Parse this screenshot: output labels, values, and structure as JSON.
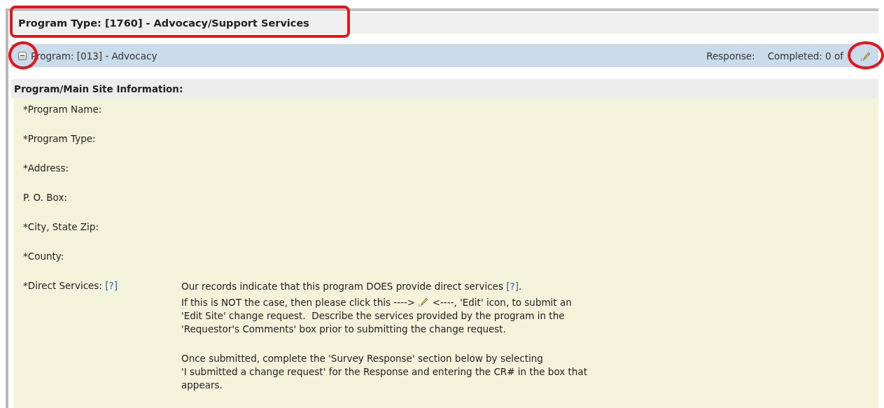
{
  "program_type": {
    "title": "Program Type: [1760] - Advocacy/Support Services"
  },
  "program": {
    "title": "Program: [013] - Advocacy",
    "expanded": true,
    "response_label": "Response:",
    "completed": "Completed: 0 of"
  },
  "section": {
    "title": "Program/Main Site Information:"
  },
  "fields": [
    {
      "label": "*Program Name:"
    },
    {
      "label": "*Program Type:"
    },
    {
      "label": "*Address:"
    },
    {
      "label": "P. O. Box:"
    },
    {
      "label": "*City, State Zip:"
    },
    {
      "label": "*County:"
    }
  ],
  "direct_services": {
    "label": "*Direct Services:",
    "help": "[?]",
    "paragraphs": [
      [
        {
          "kind": "text",
          "text": "Our records indicate that this program DOES provide direct services "
        },
        {
          "kind": "link",
          "text": "[?]"
        },
        {
          "kind": "text",
          "text": "."
        }
      ],
      [
        {
          "kind": "text",
          "text": "If this is NOT the case, then please click this ----> "
        },
        {
          "kind": "icon"
        },
        {
          "kind": "text",
          "text": " <----, 'Edit' icon, to submit an"
        },
        {
          "kind": "break"
        },
        {
          "kind": "text",
          "text": "'Edit Site' change request.  Describe the services provided by the program in the"
        },
        {
          "kind": "break"
        },
        {
          "kind": "text",
          "text": "'Requestor's Comments' box prior to submitting the change request."
        }
      ],
      [
        {
          "kind": "text",
          "text": "Once submitted, complete the 'Survey Response' section below by selecting"
        },
        {
          "kind": "break"
        },
        {
          "kind": "text",
          "text": "'I submitted a change request' for the Response and entering the CR# in the box that"
        },
        {
          "kind": "break"
        },
        {
          "kind": "text",
          "text": "appears."
        }
      ]
    ]
  }
}
